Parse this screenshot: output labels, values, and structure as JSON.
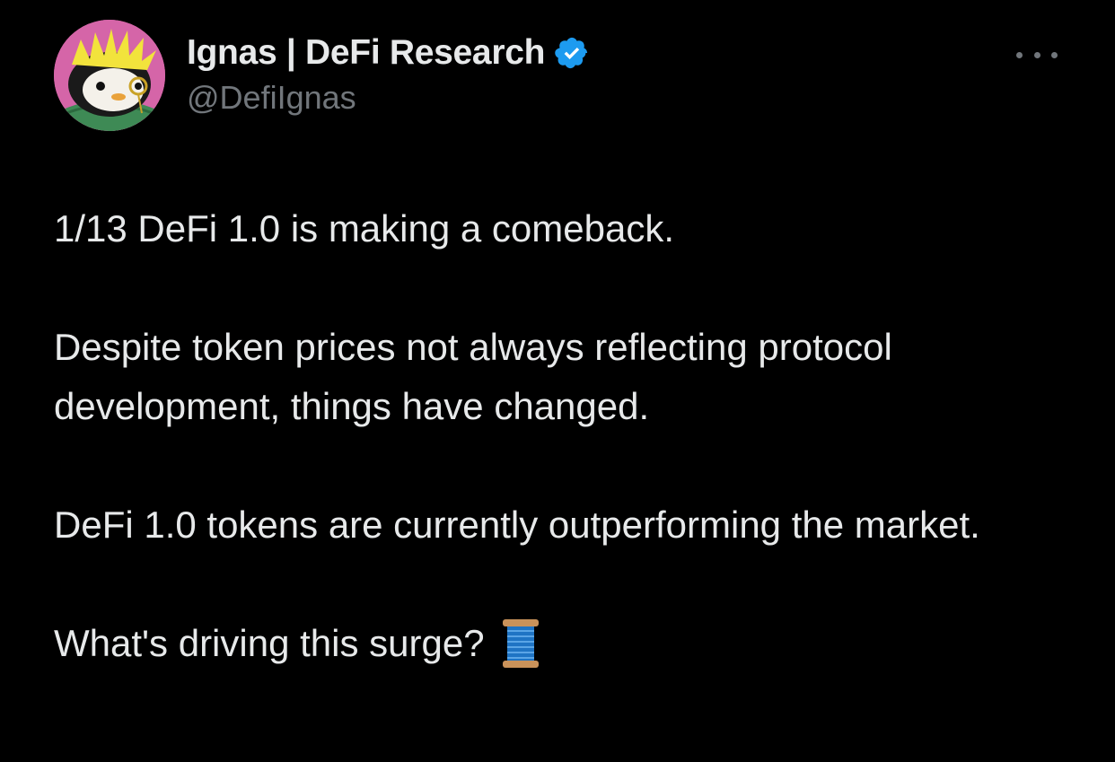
{
  "author": {
    "display_name": "Ignas | DeFi Research",
    "handle": "@DefiIgnas",
    "verified": true,
    "avatar_icon": "penguin-avatar-icon"
  },
  "menu": {
    "icon": "more-options-icon"
  },
  "tweet": {
    "paragraphs": [
      "1/13 DeFi 1.0 is making a comeback.",
      "Despite token prices not always reflecting protocol development, things have changed.",
      "DeFi 1.0 tokens are currently outperforming the market.",
      "What's driving this surge?"
    ],
    "thread_emoji": "spool-of-thread-icon"
  },
  "colors": {
    "background": "#000000",
    "text_primary": "#e7e9ea",
    "text_secondary": "#71767b",
    "verified_badge": "#1d9bf0"
  }
}
